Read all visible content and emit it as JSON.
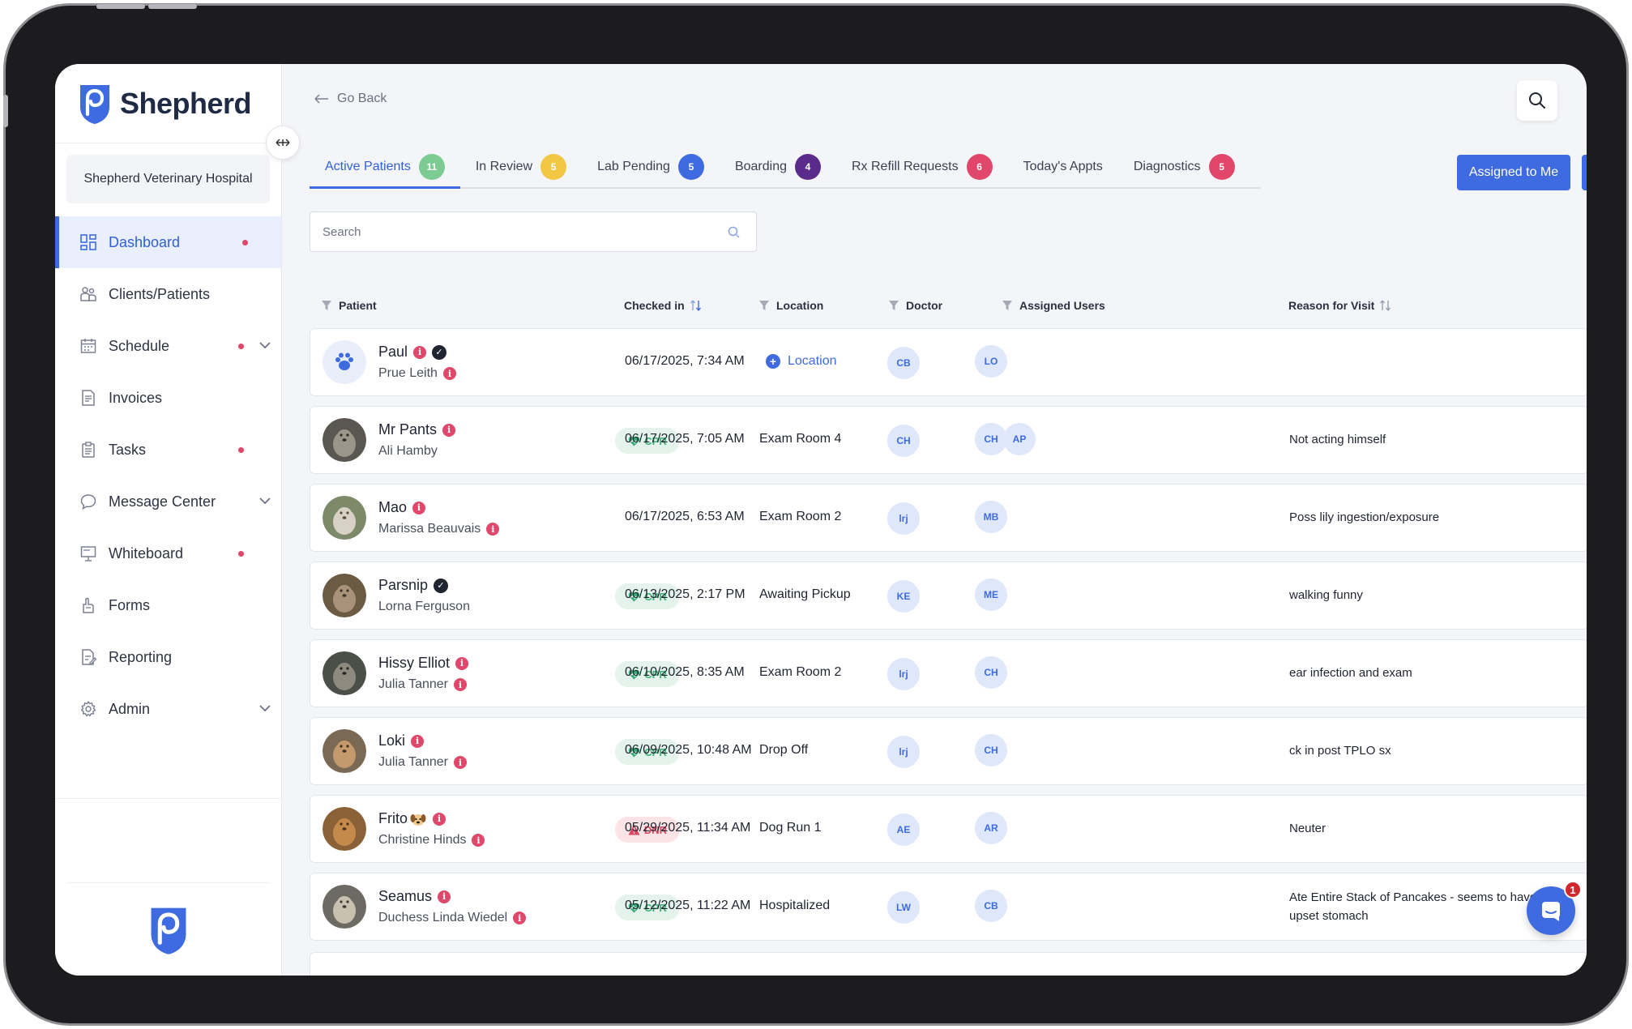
{
  "app": {
    "name": "Shepherd",
    "hospital": "Shepherd Veterinary Hospital"
  },
  "sidebar": {
    "items": [
      {
        "label": "Dashboard",
        "icon": "dashboard-icon",
        "active": true,
        "dot": true,
        "chevron": false
      },
      {
        "label": "Clients/Patients",
        "icon": "clients-icon",
        "active": false,
        "dot": false,
        "chevron": false
      },
      {
        "label": "Schedule",
        "icon": "calendar-icon",
        "active": false,
        "dot": true,
        "chevron": true
      },
      {
        "label": "Invoices",
        "icon": "invoice-icon",
        "active": false,
        "dot": false,
        "chevron": false
      },
      {
        "label": "Tasks",
        "icon": "clipboard-icon",
        "active": false,
        "dot": true,
        "chevron": false
      },
      {
        "label": "Message Center",
        "icon": "chat-icon",
        "active": false,
        "dot": false,
        "chevron": true
      },
      {
        "label": "Whiteboard",
        "icon": "whiteboard-icon",
        "active": false,
        "dot": true,
        "chevron": false
      },
      {
        "label": "Forms",
        "icon": "forms-icon",
        "active": false,
        "dot": false,
        "chevron": false
      },
      {
        "label": "Reporting",
        "icon": "reporting-icon",
        "active": false,
        "dot": false,
        "chevron": false
      },
      {
        "label": "Admin",
        "icon": "gear-icon",
        "active": false,
        "dot": false,
        "chevron": true
      }
    ]
  },
  "header": {
    "go_back": "Go Back"
  },
  "tabs": [
    {
      "label": "Active Patients",
      "count": "11",
      "color": "#7ccb93",
      "active": true
    },
    {
      "label": "In Review",
      "count": "5",
      "color": "#f2c744",
      "active": false
    },
    {
      "label": "Lab Pending",
      "count": "5",
      "color": "#3e6be0",
      "active": false
    },
    {
      "label": "Boarding",
      "count": "4",
      "color": "#5b2b8c",
      "active": false
    },
    {
      "label": "Rx Refill Requests",
      "count": "6",
      "color": "#e0476b",
      "active": false
    },
    {
      "label": "Today's Appts",
      "count": "",
      "color": "",
      "active": false
    },
    {
      "label": "Diagnostics",
      "count": "5",
      "color": "#e0476b",
      "active": false
    }
  ],
  "actions": {
    "assigned_to_me": "Assigned to Me"
  },
  "search": {
    "placeholder": "Search"
  },
  "table": {
    "columns": {
      "patient": "Patient",
      "checked_in": "Checked in",
      "location": "Location",
      "doctor": "Doctor",
      "assigned_users": "Assigned Users",
      "reason": "Reason for Visit"
    },
    "rows": [
      {
        "patient": "Paul",
        "owner": "Prue Leith",
        "avatar": "paw-placeholder",
        "tag": "",
        "checked_in": "06/17/2025, 7:34 AM",
        "location": "Location",
        "location_is_link": true,
        "doctor": "CB",
        "assigned": [
          "LO"
        ],
        "reason": ""
      },
      {
        "patient": "Mr Pants",
        "owner": "Ali Hamby",
        "avatar": "dog-photo",
        "tag": "CPR",
        "checked_in": "06/17/2025, 7:05 AM",
        "location": "Exam Room 4",
        "location_is_link": false,
        "doctor": "CH",
        "assigned": [
          "CH",
          "AP"
        ],
        "reason": "Not acting himself"
      },
      {
        "patient": "Mao",
        "owner": "Marissa Beauvais",
        "avatar": "cat-photo",
        "tag": "",
        "checked_in": "06/17/2025, 6:53 AM",
        "location": "Exam Room 2",
        "location_is_link": false,
        "doctor": "lrj",
        "assigned": [
          "MB"
        ],
        "reason": "Poss lily ingestion/exposure"
      },
      {
        "patient": "Parsnip",
        "owner": "Lorna Ferguson",
        "avatar": "chicken-photo",
        "tag": "CPR",
        "checked_in": "06/13/2025, 2:17 PM",
        "location": "Awaiting Pickup",
        "location_is_link": false,
        "doctor": "KE",
        "assigned": [
          "ME"
        ],
        "reason": "walking funny"
      },
      {
        "patient": "Hissy Elliot",
        "owner": "Julia Tanner",
        "avatar": "tabby-photo",
        "tag": "CPR",
        "checked_in": "06/10/2025, 8:35 AM",
        "location": "Exam Room 2",
        "location_is_link": false,
        "doctor": "lrj",
        "assigned": [
          "CH"
        ],
        "reason": "ear infection and exam"
      },
      {
        "patient": "Loki",
        "owner": "Julia Tanner",
        "avatar": "dog-photo",
        "tag": "CPR",
        "checked_in": "06/09/2025, 10:48 AM",
        "location": "Drop Off",
        "location_is_link": false,
        "doctor": "lrj",
        "assigned": [
          "CH"
        ],
        "reason": "ck in post TPLO sx"
      },
      {
        "patient": "Frito",
        "owner": "Christine Hinds",
        "avatar": "dog-photo",
        "tag": "DNR",
        "checked_in": "05/29/2025, 11:34 AM",
        "location": "Dog Run 1",
        "location_is_link": false,
        "doctor": "AE",
        "assigned": [
          "AR"
        ],
        "reason": "Neuter"
      },
      {
        "patient": "Seamus",
        "owner": "Duchess Linda Wiedel",
        "avatar": "dog-photo",
        "tag": "CPR",
        "checked_in": "05/12/2025, 11:22 AM",
        "location": "Hospitalized",
        "location_is_link": false,
        "doctor": "LW",
        "assigned": [
          "CB"
        ],
        "reason": "Ate Entire Stack of Pancakes - seems to have an upset stomach"
      }
    ]
  },
  "chat": {
    "unread": "1"
  },
  "colors": {
    "accent": "#3e6be0",
    "danger": "#e0476b",
    "success": "#3bb07a"
  }
}
